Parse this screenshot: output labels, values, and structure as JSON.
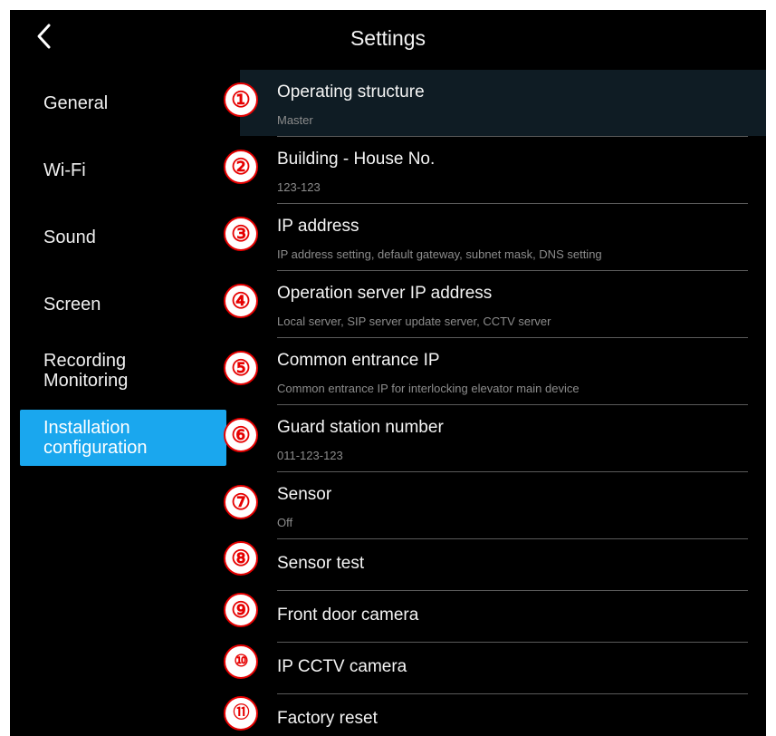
{
  "header": {
    "title": "Settings",
    "back_icon": "chevron-left-icon"
  },
  "sidebar": {
    "items": [
      {
        "label": "General"
      },
      {
        "label": "Wi-Fi"
      },
      {
        "label": "Sound"
      },
      {
        "label": "Screen"
      },
      {
        "label_line1": "Recording",
        "label_line2": "Monitoring"
      },
      {
        "label_line1": "Installation",
        "label_line2": "configuration",
        "active": true
      }
    ]
  },
  "settings": [
    {
      "marker": "①",
      "label": "Operating structure",
      "sub": "Master"
    },
    {
      "marker": "②",
      "label": "Building - House No.",
      "sub": "123-123"
    },
    {
      "marker": "③",
      "label": "IP address",
      "sub": "IP address setting, default gateway, subnet mask, DNS setting"
    },
    {
      "marker": "④",
      "label": "Operation server IP address",
      "sub": "Local server, SIP server update server, CCTV server"
    },
    {
      "marker": "⑤",
      "label": "Common entrance IP",
      "sub": "Common entrance IP for interlocking elevator main device"
    },
    {
      "marker": "⑥",
      "label": "Guard station number",
      "sub": "011-123-123"
    },
    {
      "marker": "⑦",
      "label": "Sensor",
      "sub": "Off"
    },
    {
      "marker": "⑧",
      "label": "Sensor test"
    },
    {
      "marker": "⑨",
      "label": "Front door camera"
    },
    {
      "marker": "⑩",
      "label": "IP CCTV camera"
    },
    {
      "marker": "⑪",
      "label": "Factory reset"
    }
  ],
  "colors": {
    "background": "#000000",
    "accent": "#1aa7ee",
    "marker": "#e60000",
    "highlight": "#0f1c24"
  }
}
